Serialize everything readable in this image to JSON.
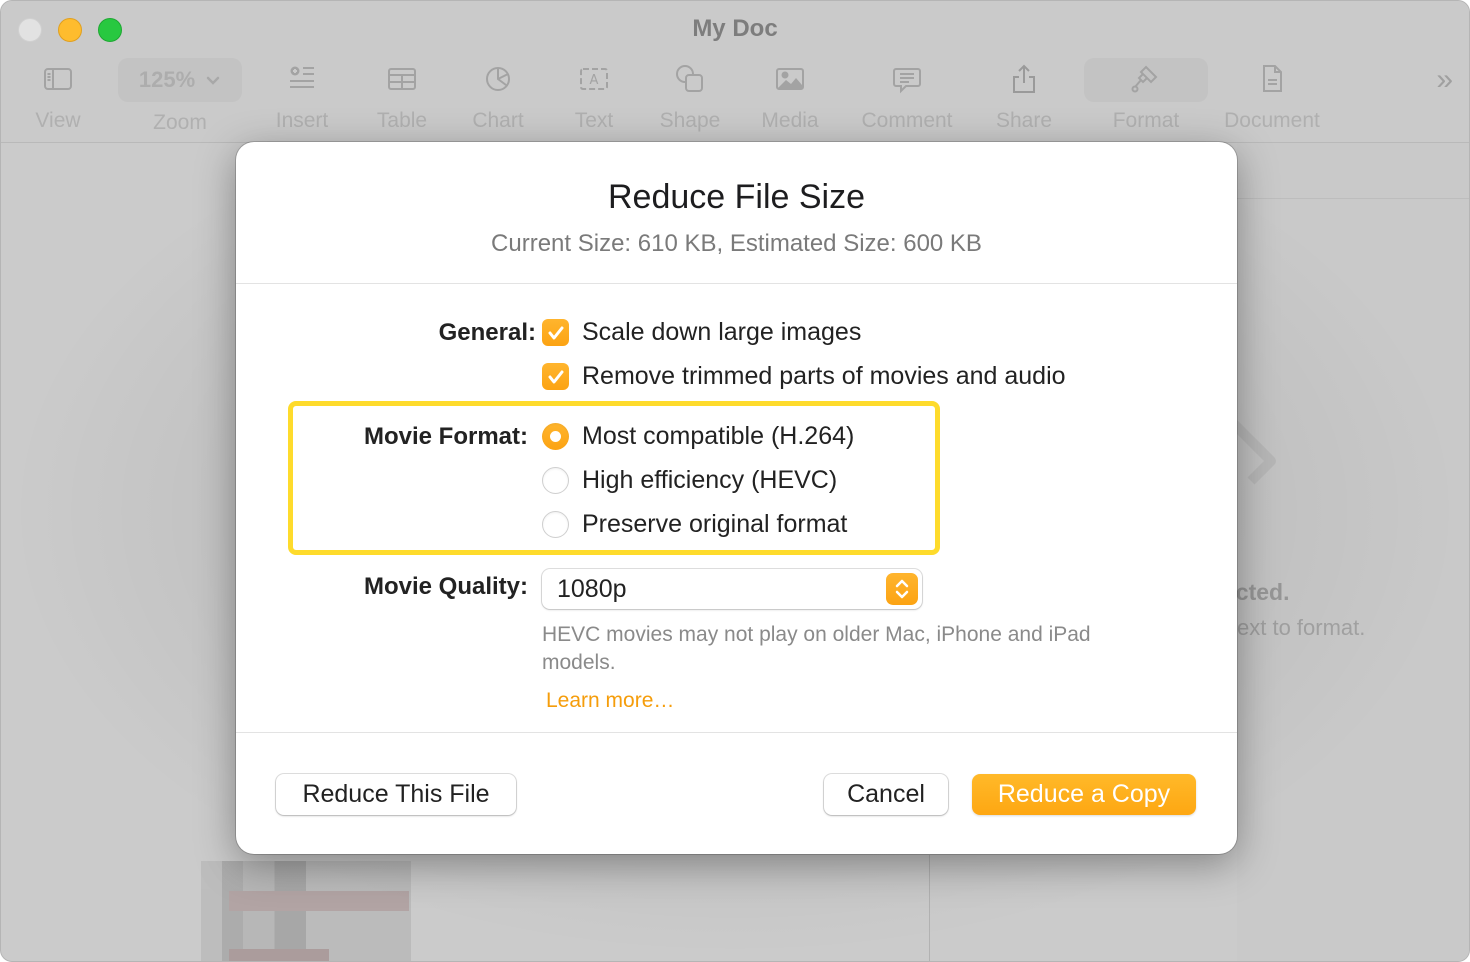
{
  "window": {
    "title": "My Doc",
    "traffic_lights": [
      "close",
      "minimize",
      "zoom"
    ]
  },
  "toolbar": {
    "items": [
      {
        "id": "view",
        "label": "View",
        "icon": "sidebar-icon"
      },
      {
        "id": "zoom",
        "label": "Zoom",
        "value": "125%",
        "icon": "chevron-down-icon"
      },
      {
        "id": "insert",
        "label": "Insert",
        "icon": "insert-list-icon"
      },
      {
        "id": "table",
        "label": "Table",
        "icon": "table-icon"
      },
      {
        "id": "chart",
        "label": "Chart",
        "icon": "pie-chart-icon"
      },
      {
        "id": "text",
        "label": "Text",
        "icon": "text-box-icon"
      },
      {
        "id": "shape",
        "label": "Shape",
        "icon": "shape-icon"
      },
      {
        "id": "media",
        "label": "Media",
        "icon": "image-icon"
      },
      {
        "id": "comment",
        "label": "Comment",
        "icon": "comment-icon"
      },
      {
        "id": "share",
        "label": "Share",
        "icon": "share-icon"
      },
      {
        "id": "format",
        "label": "Format",
        "icon": "paintbrush-icon",
        "active": true
      },
      {
        "id": "document",
        "label": "Document",
        "icon": "document-icon"
      }
    ],
    "overflow_icon": "»"
  },
  "background": {
    "sidebar_message_title": "ected.",
    "sidebar_message_subtitle": "ext to format."
  },
  "dialog": {
    "title": "Reduce File Size",
    "subtitle": "Current Size: 610 KB, Estimated Size: 600 KB",
    "general": {
      "label": "General:",
      "options": [
        {
          "label": "Scale down large images",
          "checked": true
        },
        {
          "label": "Remove trimmed parts of movies and audio",
          "checked": true
        }
      ]
    },
    "movie_format": {
      "label": "Movie Format:",
      "options": [
        {
          "label": "Most compatible (H.264)",
          "selected": true
        },
        {
          "label": "High efficiency (HEVC)",
          "selected": false
        },
        {
          "label": "Preserve original format",
          "selected": false
        }
      ]
    },
    "movie_quality": {
      "label": "Movie Quality:",
      "value": "1080p",
      "hint": "HEVC movies may not play on older Mac, iPhone and iPad models.",
      "learn_more": "Learn more…"
    },
    "buttons": {
      "reduce_this_file": "Reduce This File",
      "cancel": "Cancel",
      "reduce_a_copy": "Reduce a Copy"
    }
  },
  "colors": {
    "accent": "#fea712",
    "highlight_border": "#fedb2c",
    "link": "#f59d0b"
  }
}
